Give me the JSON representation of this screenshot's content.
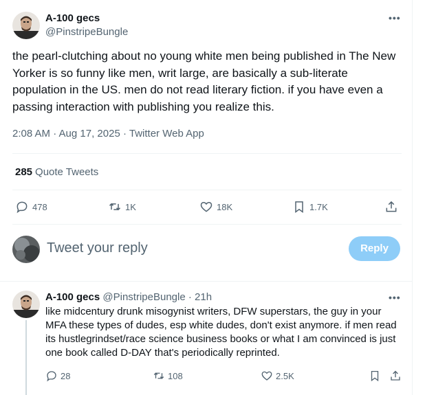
{
  "main_tweet": {
    "author_name": "A-100 gecs",
    "author_handle": "@PinstripeBungle",
    "text": "the pearl-clutching about no young white men being published in The New Yorker is so funny like men, writ large, are basically a sub-literate population in the US. men do not read literary fiction. if you have even a passing interaction with publishing you realize this.",
    "time": "2:08 AM · Aug 17, 2025",
    "source": "Twitter Web App",
    "quote_count": "285",
    "quote_label": "Quote Tweets",
    "replies": "478",
    "retweets": "1K",
    "likes": "18K",
    "bookmarks": "1.7K",
    "more_icon": "ellipsis-icon"
  },
  "composer": {
    "placeholder": "Tweet your reply",
    "reply_button": "Reply",
    "reply_button_color": "#8ecdf8"
  },
  "reply_tweet": {
    "author_name": "A-100 gecs",
    "author_handle": "@PinstripeBungle",
    "time_ago": "21h",
    "text": "like midcentury drunk misogynist writers, DFW superstars, the guy in your MFA these types of dudes, esp white dudes, don't exist anymore. if men read its hustlegrindset/race science business books or what I am convinced is just one book called D-DAY that's periodically reprinted.",
    "replies": "28",
    "retweets": "108",
    "likes": "2.5K"
  },
  "colors": {
    "text_primary": "#0f1419",
    "text_secondary": "#536471",
    "border": "#eff3f4"
  }
}
